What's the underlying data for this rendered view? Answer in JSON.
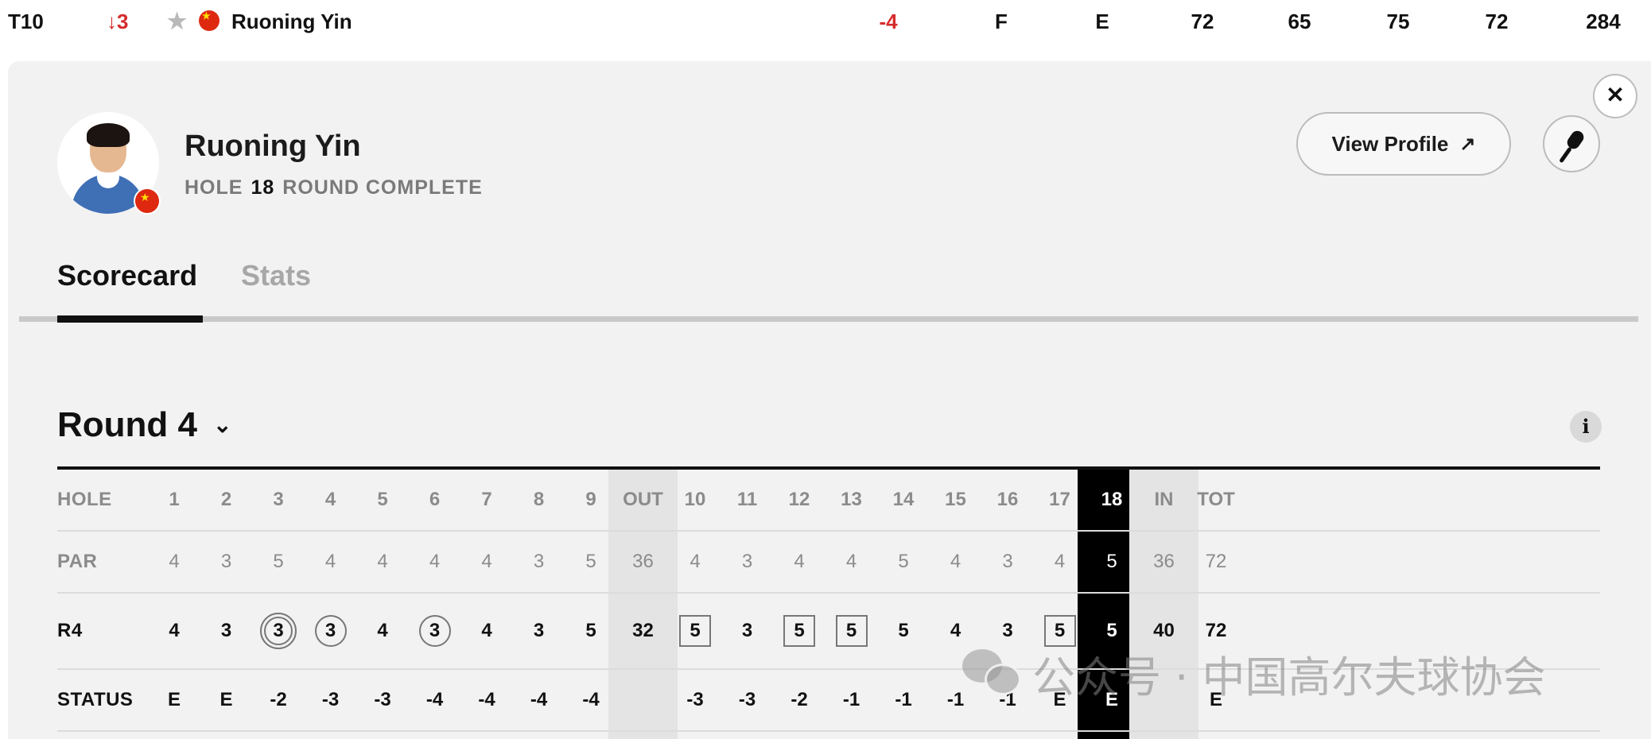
{
  "leaderboard_row": {
    "position": "T10",
    "movement": "3",
    "player_name": "Ruoning Yin",
    "to_par": "-4",
    "thru": "F",
    "today": "E",
    "r1": "72",
    "r2": "65",
    "r3": "75",
    "r4": "72",
    "total": "284"
  },
  "player": {
    "name": "Ruoning Yin",
    "hole_label": "HOLE",
    "hole_number": "18",
    "status": "ROUND COMPLETE",
    "view_profile_label": "View Profile"
  },
  "tabs": [
    {
      "label": "Scorecard",
      "active": true
    },
    {
      "label": "Stats",
      "active": false
    }
  ],
  "round": {
    "title": "Round 4",
    "info_label": "i"
  },
  "scorecard": {
    "columns": [
      "1",
      "2",
      "3",
      "4",
      "5",
      "6",
      "7",
      "8",
      "9",
      "OUT",
      "10",
      "11",
      "12",
      "13",
      "14",
      "15",
      "16",
      "17",
      "18",
      "IN",
      "TOT"
    ],
    "rows": [
      {
        "label": "HOLE",
        "values": [
          "1",
          "2",
          "3",
          "4",
          "5",
          "6",
          "7",
          "8",
          "9",
          "OUT",
          "10",
          "11",
          "12",
          "13",
          "14",
          "15",
          "16",
          "17",
          "18",
          "IN",
          "TOT"
        ]
      },
      {
        "label": "PAR",
        "values": [
          "4",
          "3",
          "5",
          "4",
          "4",
          "4",
          "4",
          "3",
          "5",
          "36",
          "4",
          "3",
          "4",
          "4",
          "5",
          "4",
          "3",
          "4",
          "5",
          "36",
          "72"
        ]
      },
      {
        "label": "R4",
        "values": [
          "4",
          "3",
          "3",
          "3",
          "4",
          "3",
          "4",
          "3",
          "5",
          "32",
          "5",
          "3",
          "5",
          "5",
          "5",
          "4",
          "3",
          "5",
          "5",
          "40",
          "72"
        ],
        "marks": [
          "",
          "",
          "eagle",
          "birdie",
          "",
          "birdie",
          "",
          "",
          "",
          "",
          "bogey",
          "",
          "bogey",
          "bogey",
          "",
          "",
          "",
          "bogey",
          "",
          "",
          ""
        ]
      },
      {
        "label": "STATUS",
        "values": [
          "E",
          "E",
          "-2",
          "-3",
          "-3",
          "-4",
          "-4",
          "-4",
          "-4",
          "",
          "-3",
          "-3",
          "-2",
          "-1",
          "-1",
          "-1",
          "-1",
          "E",
          "E",
          "",
          "E"
        ]
      }
    ],
    "highlight_column": "18",
    "shaded_columns": [
      "OUT",
      "IN"
    ]
  },
  "watermark": "公众号 · 中国高尔夫球协会",
  "colors": {
    "accent_red": "#d62b2b",
    "panel_bg": "#f2f2f2",
    "highlight_bg": "#000000"
  },
  "icons": [
    "arrow-down-icon",
    "star-icon",
    "china-flag-icon",
    "close-icon",
    "external-link-icon",
    "microphone-icon",
    "chevron-down-icon",
    "info-icon",
    "wechat-icon"
  ]
}
